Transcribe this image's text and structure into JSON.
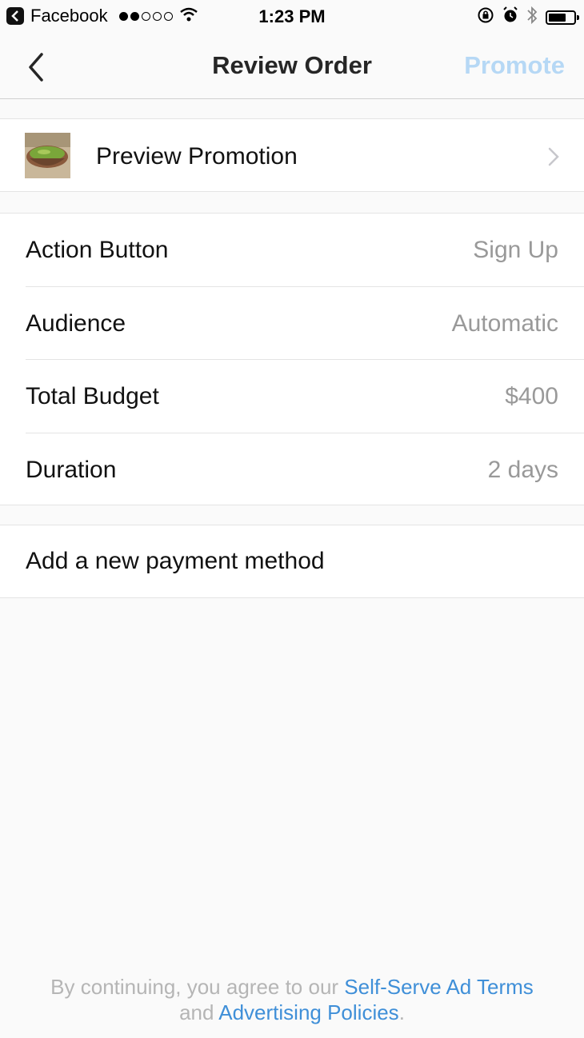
{
  "status_bar": {
    "back_app": "Facebook",
    "time": "1:23 PM"
  },
  "nav": {
    "title": "Review Order",
    "action_label": "Promote"
  },
  "preview": {
    "label": "Preview Promotion"
  },
  "details": [
    {
      "label": "Action Button",
      "value": "Sign Up"
    },
    {
      "label": "Audience",
      "value": "Automatic"
    },
    {
      "label": "Total Budget",
      "value": "$400"
    },
    {
      "label": "Duration",
      "value": "2 days"
    }
  ],
  "payment": {
    "label": "Add a new payment method"
  },
  "footer": {
    "prefix": "By continuing, you agree to our ",
    "terms_link": "Self-Serve Ad Terms",
    "joiner": "and ",
    "policies_link": "Advertising Policies",
    "suffix": "."
  },
  "colors": {
    "accent_disabled": "#b6d8f5",
    "link": "#3f8fd8",
    "value_gray": "#999999"
  }
}
